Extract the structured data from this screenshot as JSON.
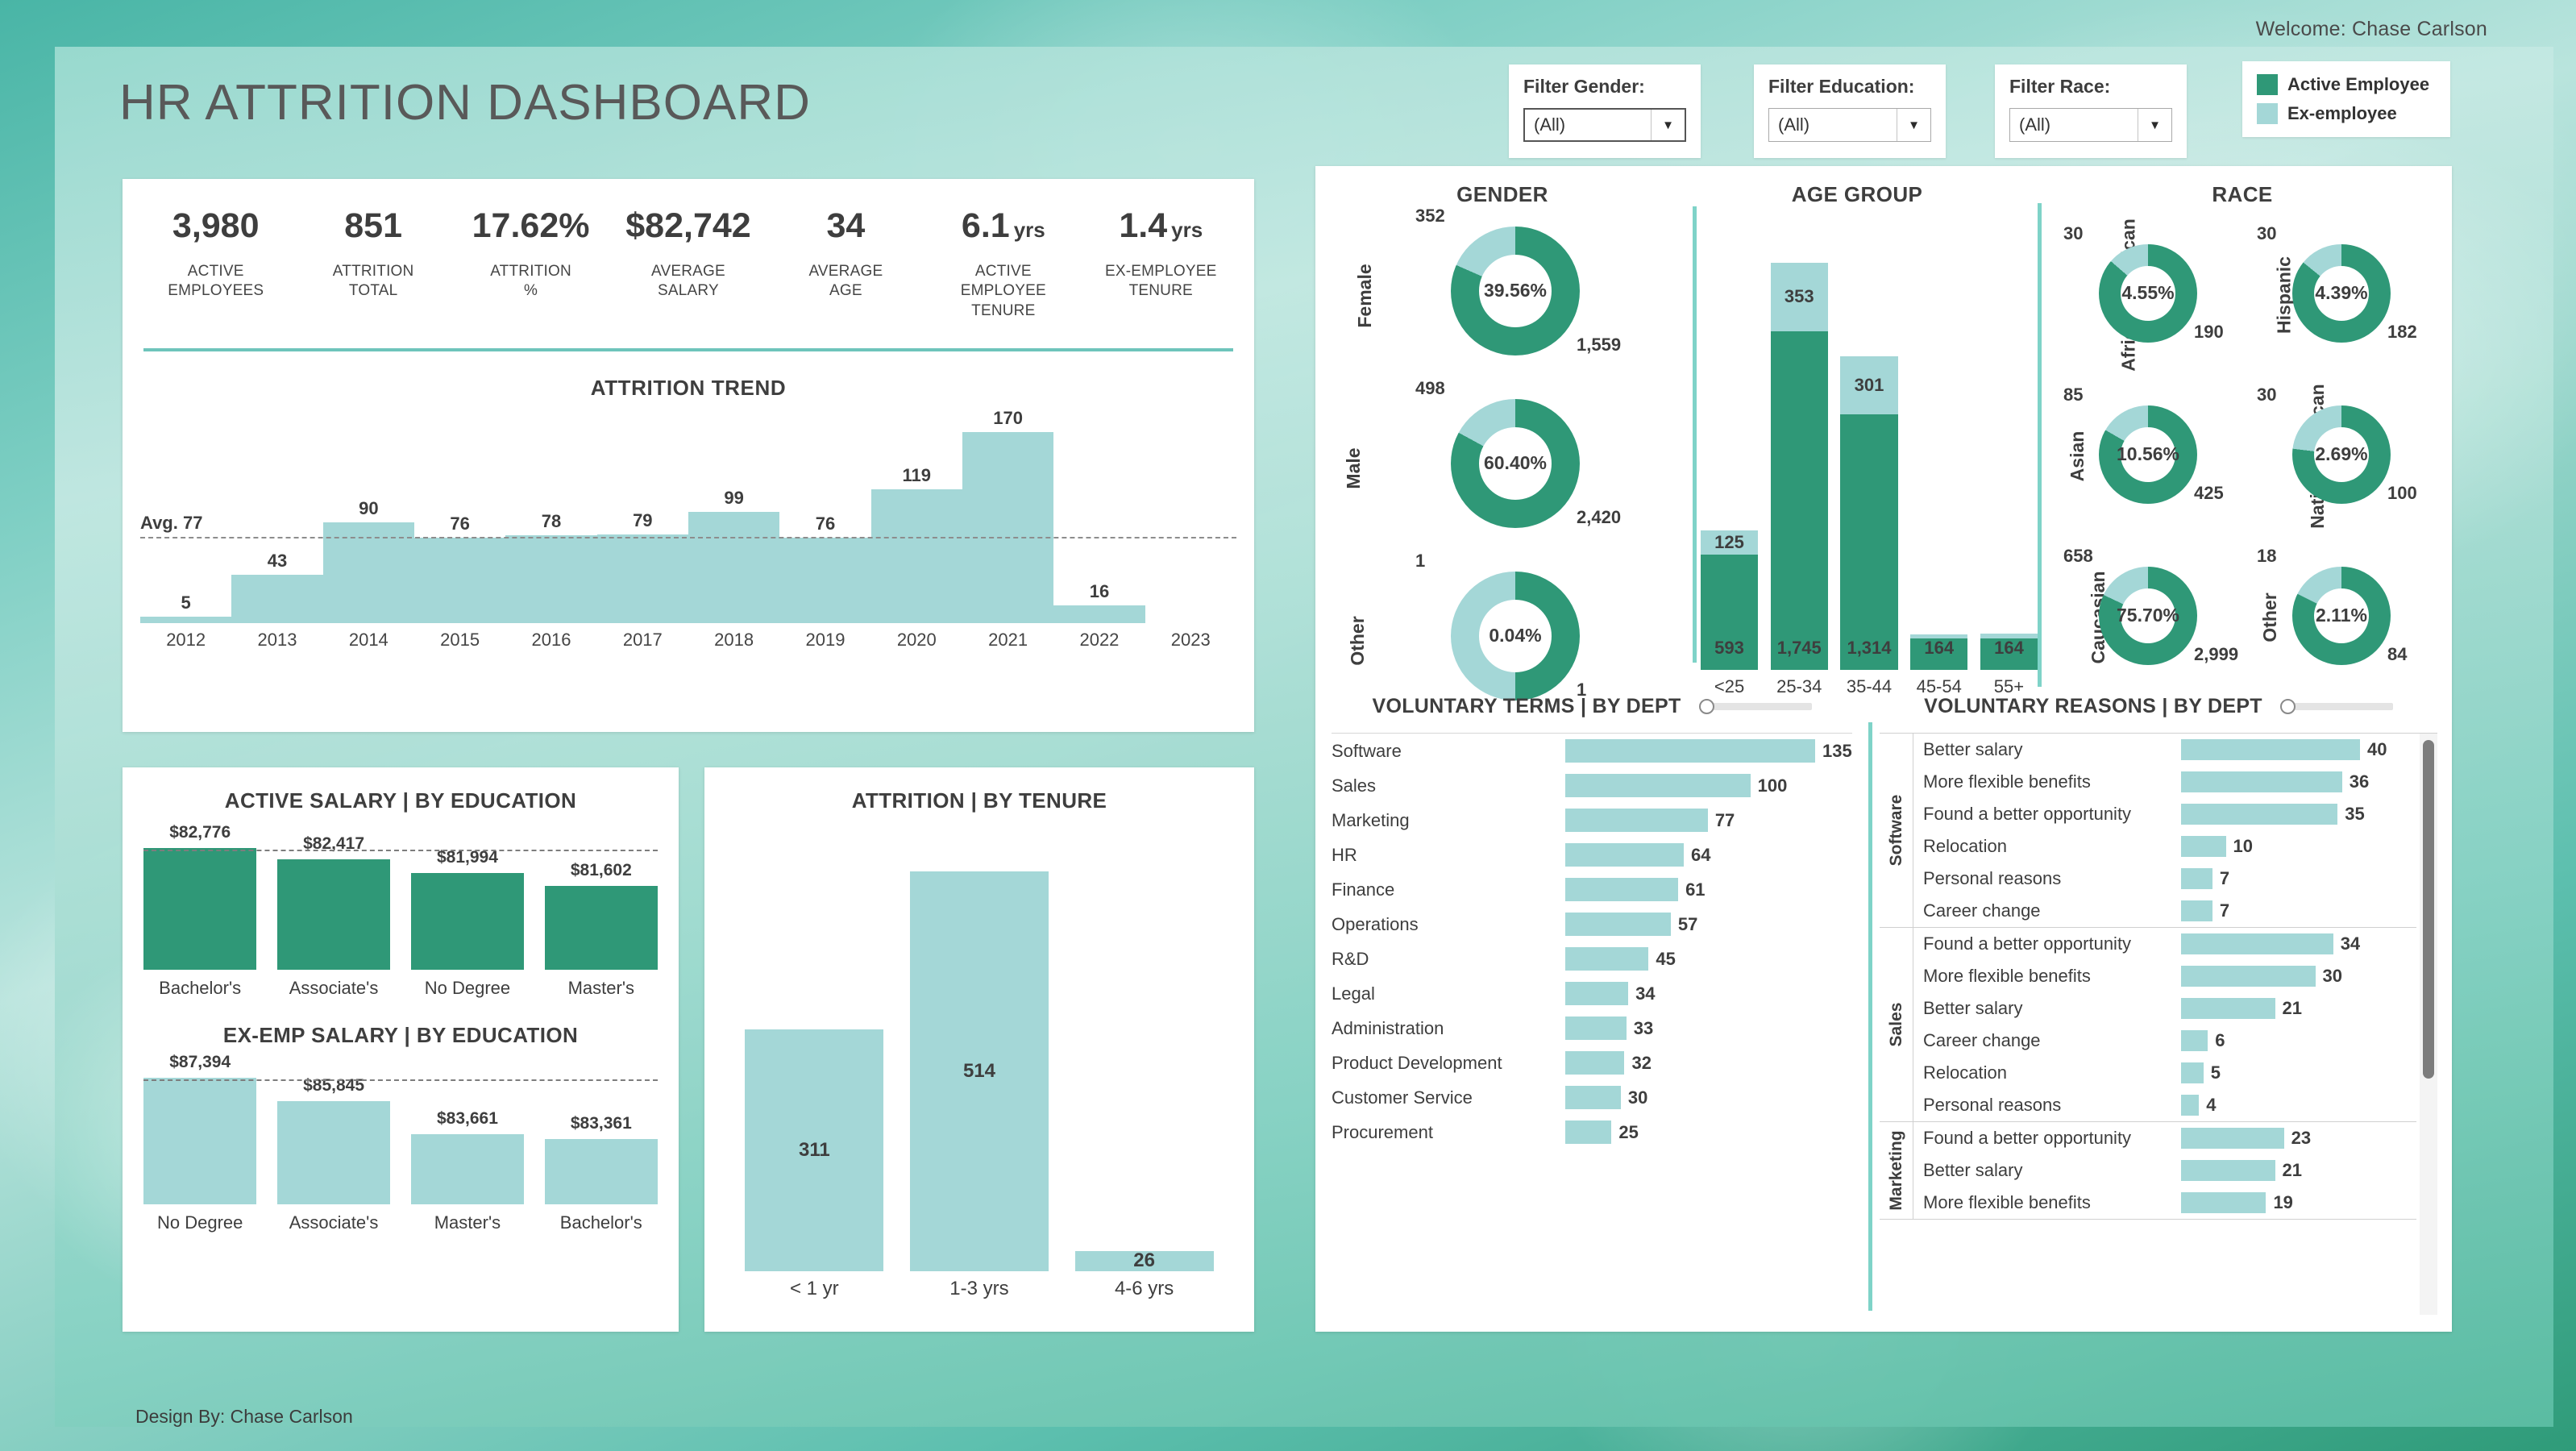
{
  "header": {
    "welcome": "Welcome: Chase Carlson",
    "title": "HR ATTRITION DASHBOARD",
    "footer": "Design By: Chase Carlson"
  },
  "colors": {
    "active": "#2f9877",
    "ex": "#a4d7d7",
    "accent": "#6ec4bb"
  },
  "filters": [
    {
      "label": "Filter Gender:",
      "value": "(All)"
    },
    {
      "label": "Filter Education:",
      "value": "(All)"
    },
    {
      "label": "Filter Race:",
      "value": "(All)"
    }
  ],
  "legend": [
    {
      "label": "Active Employee",
      "color": "#2f9877"
    },
    {
      "label": "Ex-employee",
      "color": "#a4d7d7"
    }
  ],
  "kpis": [
    {
      "value": "3,980",
      "unit": "",
      "label": "ACTIVE\nEMPLOYEES"
    },
    {
      "value": "851",
      "unit": "",
      "label": "ATTRITION\nTOTAL"
    },
    {
      "value": "17.62%",
      "unit": "",
      "label": "ATTRITION\n%"
    },
    {
      "value": "$82,742",
      "unit": "",
      "label": "AVERAGE\nSALARY"
    },
    {
      "value": "34",
      "unit": "",
      "label": "AVERAGE\nAGE"
    },
    {
      "value": "6.1",
      "unit": "yrs",
      "label": "ACTIVE\nEMPLOYEE\nTENURE"
    },
    {
      "value": "1.4",
      "unit": "yrs",
      "label": "EX-EMPLOYEE\nTENURE"
    }
  ],
  "chart_data": [
    {
      "type": "bar",
      "id": "attrition-trend",
      "title": "ATTRITION TREND",
      "categories": [
        "2012",
        "2013",
        "2014",
        "2015",
        "2016",
        "2017",
        "2018",
        "2019",
        "2020",
        "2021",
        "2022",
        "2023"
      ],
      "values": [
        5,
        43,
        90,
        76,
        78,
        79,
        99,
        76,
        119,
        170,
        16,
        null
      ],
      "average": 77,
      "average_label": "Avg. 77",
      "ylim": [
        0,
        185
      ],
      "xlabel": "",
      "ylabel": "",
      "grid": false,
      "legend": "none"
    },
    {
      "type": "bar",
      "id": "active-salary-by-education",
      "title": "ACTIVE SALARY | BY EDUCATION",
      "categories": [
        "Bachelor's",
        "Associate's",
        "No Degree",
        "Master's"
      ],
      "values": [
        82776,
        82417,
        81994,
        81602
      ],
      "value_labels": [
        "$82,776",
        "$82,417",
        "$81,994",
        "$81,602"
      ],
      "ylim": [
        79000,
        83200
      ],
      "ylabel": "",
      "xlabel": ""
    },
    {
      "type": "bar",
      "id": "exemp-salary-by-education",
      "title": "EX-EMP SALARY | BY EDUCATION",
      "categories": [
        "No Degree",
        "Associate's",
        "Master's",
        "Bachelor's"
      ],
      "values": [
        87394,
        85845,
        83661,
        83361
      ],
      "value_labels": [
        "$87,394",
        "$85,845",
        "$83,661",
        "$83,361"
      ],
      "ylim": [
        79000,
        88000
      ],
      "ylabel": "",
      "xlabel": ""
    },
    {
      "type": "bar",
      "id": "attrition-by-tenure",
      "title": "ATTRITION | BY TENURE",
      "categories": [
        "< 1 yr",
        "1-3 yrs",
        "4-6 yrs"
      ],
      "values": [
        311,
        514,
        26
      ],
      "ylim": [
        0,
        560
      ],
      "ylabel": "",
      "xlabel": ""
    },
    {
      "type": "pie",
      "id": "gender-donuts",
      "title": "GENDER",
      "series": [
        {
          "name": "Female",
          "center": "39.56%",
          "active": 1559,
          "ex": 352,
          "active_label": "1,559",
          "ex_label": "352"
        },
        {
          "name": "Male",
          "center": "60.40%",
          "active": 2420,
          "ex": 498,
          "active_label": "2,420",
          "ex_label": "498"
        },
        {
          "name": "Other",
          "center": "0.04%",
          "active": 1,
          "ex": 1,
          "active_label": "1",
          "ex_label": "1"
        }
      ]
    },
    {
      "type": "bar",
      "id": "age-group",
      "title": "AGE GROUP",
      "categories": [
        "<25",
        "25-34",
        "35-44",
        "45-54",
        "55+"
      ],
      "series": [
        {
          "name": "Active Employee",
          "values": [
            593,
            1745,
            1314,
            164,
            164
          ],
          "labels": [
            "593",
            "1,745",
            "1,314",
            "164",
            "164"
          ]
        },
        {
          "name": "Ex-employee",
          "values": [
            125,
            353,
            301,
            18,
            24
          ],
          "labels": [
            "125",
            "353",
            "301",
            "",
            ""
          ]
        }
      ],
      "stacked": true,
      "ylim": [
        0,
        2200
      ]
    },
    {
      "type": "pie",
      "id": "race-donuts",
      "title": "RACE",
      "series": [
        {
          "name": "African American",
          "center": "4.55%",
          "active_label": "190",
          "ex_label": "30",
          "active": 190,
          "ex": 30
        },
        {
          "name": "Hispanic",
          "center": "4.39%",
          "active_label": "182",
          "ex_label": "30",
          "active": 182,
          "ex": 30
        },
        {
          "name": "Asian",
          "center": "10.56%",
          "active_label": "425",
          "ex_label": "85",
          "active": 425,
          "ex": 85
        },
        {
          "name": "Native American",
          "center": "2.69%",
          "active_label": "100",
          "ex_label": "30",
          "active": 100,
          "ex": 30
        },
        {
          "name": "Caucasian",
          "center": "75.70%",
          "active_label": "2,999",
          "ex_label": "658",
          "active": 2999,
          "ex": 658
        },
        {
          "name": "Other",
          "center": "2.11%",
          "active_label": "84",
          "ex_label": "18",
          "active": 84,
          "ex": 18
        }
      ]
    },
    {
      "type": "bar",
      "id": "voluntary-terms-by-dept",
      "title": "VOLUNTARY TERMS | BY DEPT",
      "orientation": "horizontal",
      "categories": [
        "Software",
        "Sales",
        "Marketing",
        "HR",
        "Finance",
        "Operations",
        "R&D",
        "Legal",
        "Administration",
        "Product Development",
        "Customer Service",
        "Procurement"
      ],
      "values": [
        135,
        100,
        77,
        64,
        61,
        57,
        45,
        34,
        33,
        32,
        30,
        25
      ],
      "xlim": [
        0,
        135
      ]
    },
    {
      "type": "bar",
      "id": "voluntary-reasons-by-dept",
      "title": "VOLUNTARY REASONS | BY DEPT",
      "orientation": "horizontal",
      "groups": [
        {
          "dept": "Software",
          "categories": [
            "Better salary",
            "More flexible benefits",
            "Found a better opportunity",
            "Relocation",
            "Personal reasons",
            "Career change"
          ],
          "values": [
            40,
            36,
            35,
            10,
            7,
            7
          ]
        },
        {
          "dept": "Sales",
          "categories": [
            "Found a better opportunity",
            "More flexible benefits",
            "Better salary",
            "Career change",
            "Relocation",
            "Personal reasons"
          ],
          "values": [
            34,
            30,
            21,
            6,
            5,
            4
          ]
        },
        {
          "dept": "Marketing",
          "categories": [
            "Found a better opportunity",
            "Better salary",
            "More flexible benefits"
          ],
          "values": [
            23,
            21,
            19
          ]
        }
      ],
      "xlim": [
        0,
        40
      ]
    }
  ]
}
